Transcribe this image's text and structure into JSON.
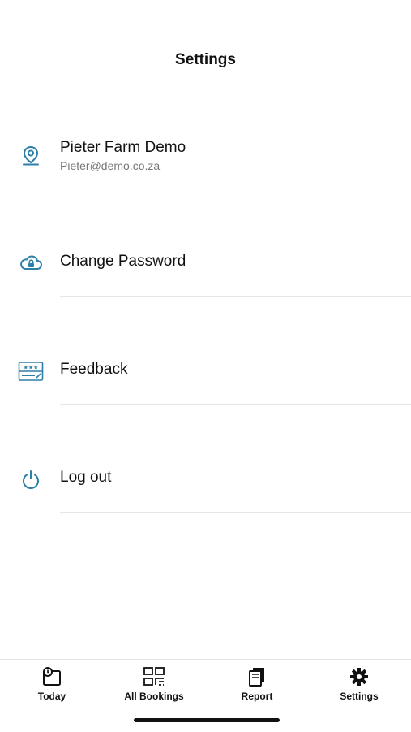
{
  "header": {
    "title": "Settings"
  },
  "settings": {
    "account": {
      "name": "Pieter Farm Demo",
      "email": "Pieter@demo.co.za",
      "icon": "location-pin-icon"
    },
    "change_password": {
      "label": "Change Password",
      "icon": "cloud-lock-icon"
    },
    "feedback": {
      "label": "Feedback",
      "icon": "rating-stars-icon"
    },
    "logout": {
      "label": "Log out",
      "icon": "power-icon"
    }
  },
  "tabbar": {
    "items": [
      {
        "label": "Today",
        "icon": "calendar-today-icon"
      },
      {
        "label": "All Bookings",
        "icon": "grid-bookings-icon"
      },
      {
        "label": "Report",
        "icon": "report-document-icon"
      },
      {
        "label": "Settings",
        "icon": "gear-icon"
      }
    ],
    "active": "Settings"
  },
  "colors": {
    "accent_icon": "#2e7fa8",
    "text": "#111111",
    "subtext": "#777777",
    "divider": "#e6e6e6"
  }
}
